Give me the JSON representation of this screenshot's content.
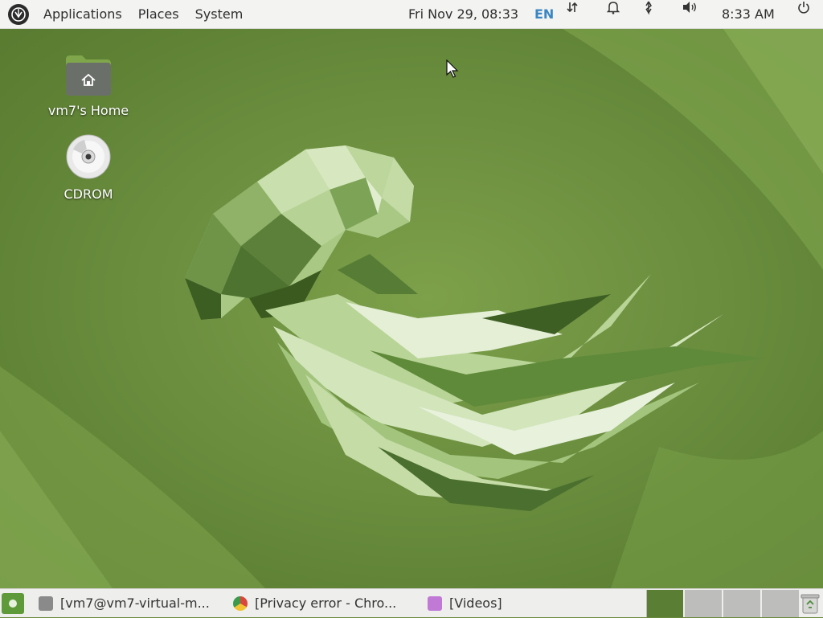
{
  "top_panel": {
    "menus": [
      "Applications",
      "Places",
      "System"
    ],
    "datetime": "Fri Nov 29, 08:33",
    "keyboard_layout": "EN",
    "clock": "8:33 AM",
    "tray_icons": [
      "network-icon",
      "notification-bell-icon",
      "bluetooth-icon",
      "volume-icon",
      "power-icon"
    ]
  },
  "desktop": {
    "icons": [
      {
        "label": "vm7's Home",
        "icon": "home-folder-icon"
      },
      {
        "label": "CDROM",
        "icon": "cdrom-icon"
      }
    ]
  },
  "taskbar": {
    "tasks": [
      {
        "label": "[vm7@vm7-virtual-m...",
        "icon": "terminal-icon"
      },
      {
        "label": "[Privacy error - Chro...",
        "icon": "chrome-icon"
      },
      {
        "label": "[Videos]",
        "icon": "videos-icon"
      }
    ],
    "workspaces": 4,
    "active_workspace": 1
  },
  "colors": {
    "wallpaper": "#6d9040",
    "accent": "#3b86c4",
    "panel": "#f3f3f1"
  }
}
